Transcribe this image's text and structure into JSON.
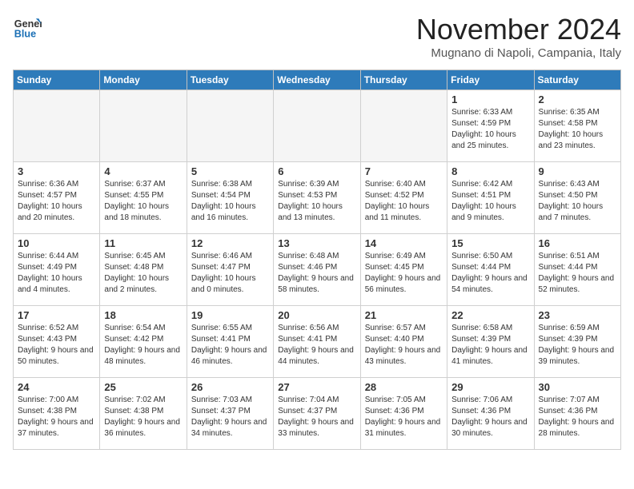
{
  "header": {
    "logo_line1": "General",
    "logo_line2": "Blue",
    "month": "November 2024",
    "location": "Mugnano di Napoli, Campania, Italy"
  },
  "days_of_week": [
    "Sunday",
    "Monday",
    "Tuesday",
    "Wednesday",
    "Thursday",
    "Friday",
    "Saturday"
  ],
  "weeks": [
    [
      {
        "day": "",
        "info": ""
      },
      {
        "day": "",
        "info": ""
      },
      {
        "day": "",
        "info": ""
      },
      {
        "day": "",
        "info": ""
      },
      {
        "day": "",
        "info": ""
      },
      {
        "day": "1",
        "info": "Sunrise: 6:33 AM\nSunset: 4:59 PM\nDaylight: 10 hours and 25 minutes."
      },
      {
        "day": "2",
        "info": "Sunrise: 6:35 AM\nSunset: 4:58 PM\nDaylight: 10 hours and 23 minutes."
      }
    ],
    [
      {
        "day": "3",
        "info": "Sunrise: 6:36 AM\nSunset: 4:57 PM\nDaylight: 10 hours and 20 minutes."
      },
      {
        "day": "4",
        "info": "Sunrise: 6:37 AM\nSunset: 4:55 PM\nDaylight: 10 hours and 18 minutes."
      },
      {
        "day": "5",
        "info": "Sunrise: 6:38 AM\nSunset: 4:54 PM\nDaylight: 10 hours and 16 minutes."
      },
      {
        "day": "6",
        "info": "Sunrise: 6:39 AM\nSunset: 4:53 PM\nDaylight: 10 hours and 13 minutes."
      },
      {
        "day": "7",
        "info": "Sunrise: 6:40 AM\nSunset: 4:52 PM\nDaylight: 10 hours and 11 minutes."
      },
      {
        "day": "8",
        "info": "Sunrise: 6:42 AM\nSunset: 4:51 PM\nDaylight: 10 hours and 9 minutes."
      },
      {
        "day": "9",
        "info": "Sunrise: 6:43 AM\nSunset: 4:50 PM\nDaylight: 10 hours and 7 minutes."
      }
    ],
    [
      {
        "day": "10",
        "info": "Sunrise: 6:44 AM\nSunset: 4:49 PM\nDaylight: 10 hours and 4 minutes."
      },
      {
        "day": "11",
        "info": "Sunrise: 6:45 AM\nSunset: 4:48 PM\nDaylight: 10 hours and 2 minutes."
      },
      {
        "day": "12",
        "info": "Sunrise: 6:46 AM\nSunset: 4:47 PM\nDaylight: 10 hours and 0 minutes."
      },
      {
        "day": "13",
        "info": "Sunrise: 6:48 AM\nSunset: 4:46 PM\nDaylight: 9 hours and 58 minutes."
      },
      {
        "day": "14",
        "info": "Sunrise: 6:49 AM\nSunset: 4:45 PM\nDaylight: 9 hours and 56 minutes."
      },
      {
        "day": "15",
        "info": "Sunrise: 6:50 AM\nSunset: 4:44 PM\nDaylight: 9 hours and 54 minutes."
      },
      {
        "day": "16",
        "info": "Sunrise: 6:51 AM\nSunset: 4:44 PM\nDaylight: 9 hours and 52 minutes."
      }
    ],
    [
      {
        "day": "17",
        "info": "Sunrise: 6:52 AM\nSunset: 4:43 PM\nDaylight: 9 hours and 50 minutes."
      },
      {
        "day": "18",
        "info": "Sunrise: 6:54 AM\nSunset: 4:42 PM\nDaylight: 9 hours and 48 minutes."
      },
      {
        "day": "19",
        "info": "Sunrise: 6:55 AM\nSunset: 4:41 PM\nDaylight: 9 hours and 46 minutes."
      },
      {
        "day": "20",
        "info": "Sunrise: 6:56 AM\nSunset: 4:41 PM\nDaylight: 9 hours and 44 minutes."
      },
      {
        "day": "21",
        "info": "Sunrise: 6:57 AM\nSunset: 4:40 PM\nDaylight: 9 hours and 43 minutes."
      },
      {
        "day": "22",
        "info": "Sunrise: 6:58 AM\nSunset: 4:39 PM\nDaylight: 9 hours and 41 minutes."
      },
      {
        "day": "23",
        "info": "Sunrise: 6:59 AM\nSunset: 4:39 PM\nDaylight: 9 hours and 39 minutes."
      }
    ],
    [
      {
        "day": "24",
        "info": "Sunrise: 7:00 AM\nSunset: 4:38 PM\nDaylight: 9 hours and 37 minutes."
      },
      {
        "day": "25",
        "info": "Sunrise: 7:02 AM\nSunset: 4:38 PM\nDaylight: 9 hours and 36 minutes."
      },
      {
        "day": "26",
        "info": "Sunrise: 7:03 AM\nSunset: 4:37 PM\nDaylight: 9 hours and 34 minutes."
      },
      {
        "day": "27",
        "info": "Sunrise: 7:04 AM\nSunset: 4:37 PM\nDaylight: 9 hours and 33 minutes."
      },
      {
        "day": "28",
        "info": "Sunrise: 7:05 AM\nSunset: 4:36 PM\nDaylight: 9 hours and 31 minutes."
      },
      {
        "day": "29",
        "info": "Sunrise: 7:06 AM\nSunset: 4:36 PM\nDaylight: 9 hours and 30 minutes."
      },
      {
        "day": "30",
        "info": "Sunrise: 7:07 AM\nSunset: 4:36 PM\nDaylight: 9 hours and 28 minutes."
      }
    ]
  ]
}
